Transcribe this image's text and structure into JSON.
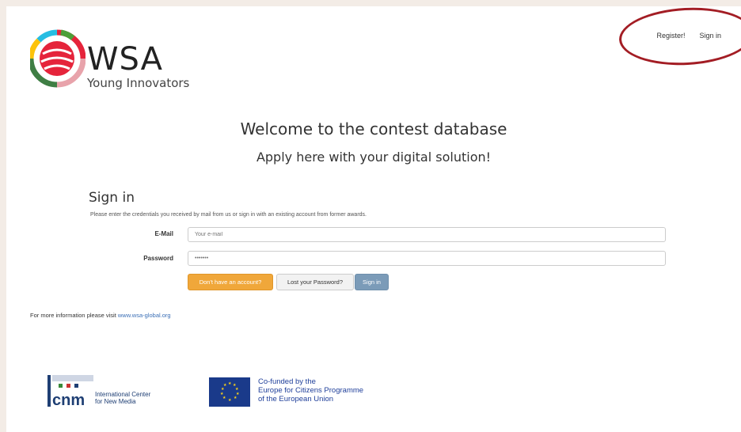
{
  "header": {
    "logo_title": "WSA",
    "logo_subtitle": "Young Innovators",
    "nav": {
      "register": "Register!",
      "signin": "Sign in"
    }
  },
  "hero": {
    "welcome": "Welcome to the contest database",
    "apply": "Apply here with your digital solution!"
  },
  "signin": {
    "title": "Sign in",
    "description": "Please enter the credentials you received by mail from us or sign in with an existing account from former awards.",
    "email_label": "E-Mail",
    "email_placeholder": "Your e-mail",
    "password_label": "Password",
    "password_placeholder": "•••••••",
    "btn_no_account": "Don't have an account?",
    "btn_lost_password": "Lost your Password?",
    "btn_signin": "Sign in"
  },
  "footer": {
    "info_prefix": "For more information please visit",
    "info_link": "www.wsa-global.org",
    "cnm_abbr": "cnm",
    "cnm_line1": "International Center",
    "cnm_line2": "for New Media",
    "eu_line1": "Co-funded by the",
    "eu_line2": "Europe for Citizens Programme",
    "eu_line3": "of the European Union"
  },
  "colors": {
    "annotation_circle": "#a31d24",
    "button_orange": "#f0a73a",
    "button_blue": "#7b9bb8",
    "link": "#3b6fb6",
    "eu_blue": "#1a3a8a"
  }
}
